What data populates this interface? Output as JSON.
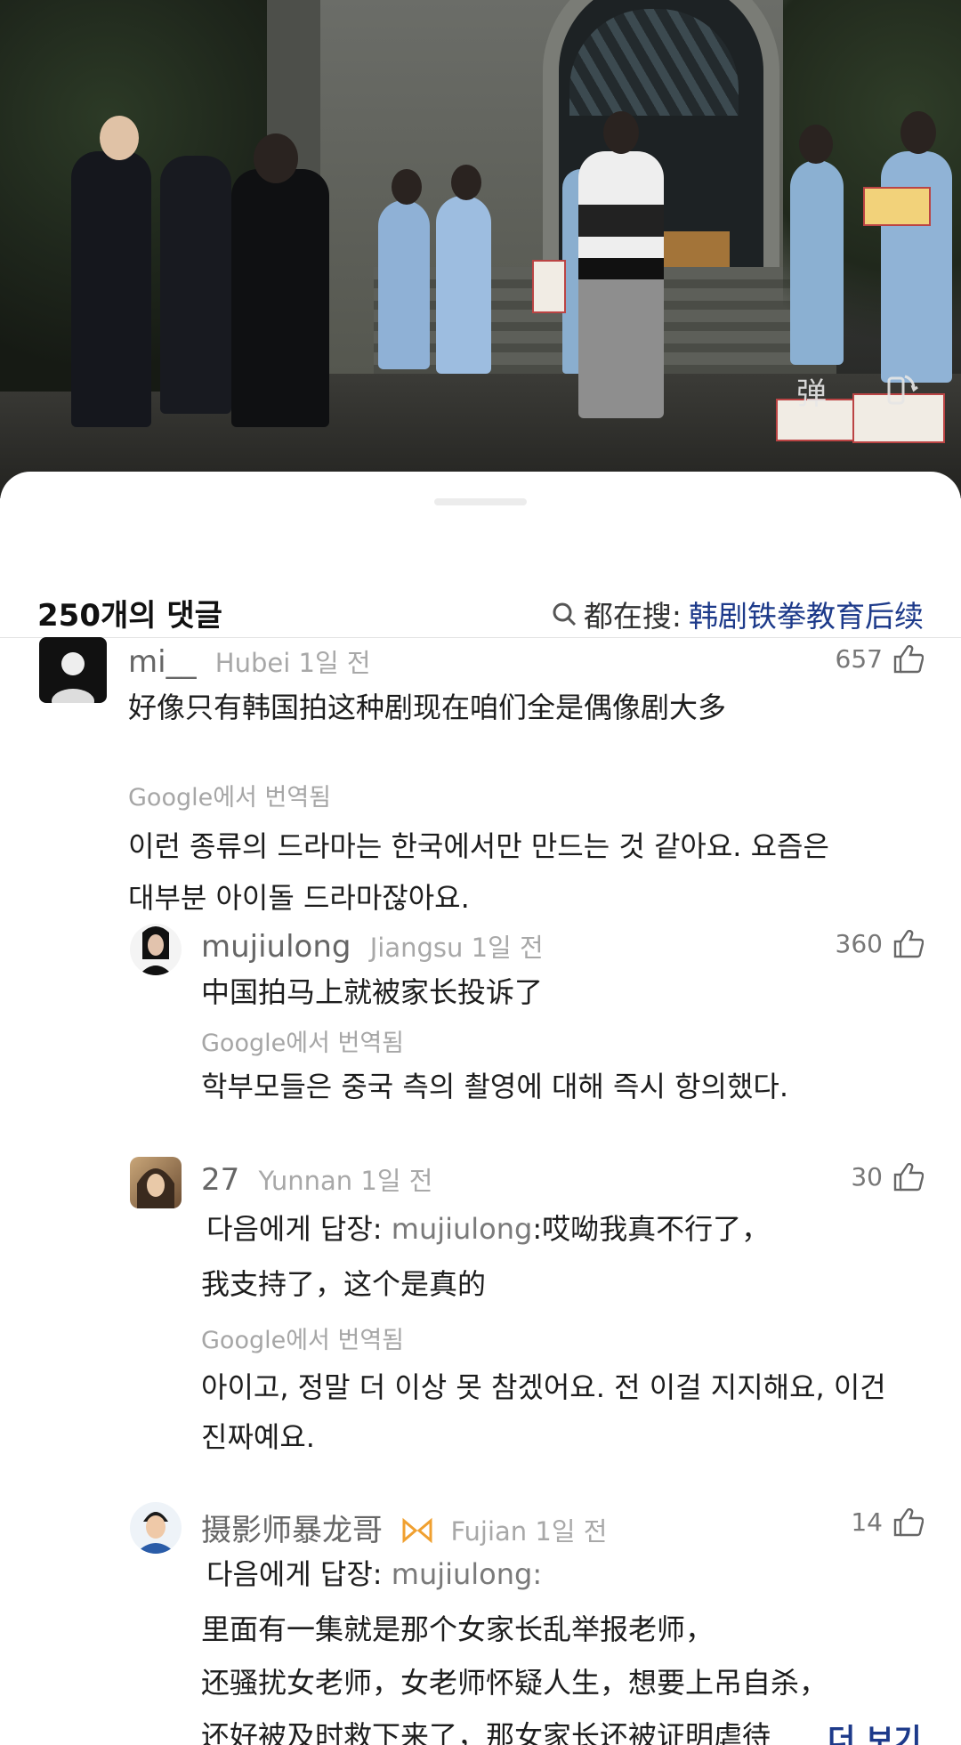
{
  "video": {
    "danmaku_icon": "弹",
    "rotate_icon": "rotate-screen-icon"
  },
  "header": {
    "comment_count": "250개의 댓글",
    "trending_label": "都在搜:",
    "trending_query": "韩剧铁拳教育后续"
  },
  "comments": [
    {
      "user": "mi__",
      "location": "Hubei",
      "time": "1일 전",
      "likes": "657",
      "text": "好像只有韩国拍这种剧现在咱们全是偶像剧大多",
      "translated_by": "Google에서 번역됨",
      "translation_line1": "이런 종류의 드라마는 한국에서만 만드는 것 같아요. 요즘은",
      "translation_line2": "대부분 아이돌 드라마잖아요."
    },
    {
      "user": "mujiulong",
      "location": "Jiangsu",
      "time": "1일 전",
      "likes": "360",
      "text": "中国拍马上就被家长投诉了",
      "translated_by": "Google에서 번역됨",
      "translation": "학부모들은 중국 측의 촬영에 대해 즉시 항의했다."
    },
    {
      "user": "27",
      "location": "Yunnan",
      "time": "1일 전",
      "likes": "30",
      "reply_prefix": "다음에게 답장:",
      "reply_to": "mujiulong",
      "text_line1": ":哎呦我真不行了，",
      "text_line2": "我支持了，这个是真的",
      "translated_by": "Google에서 번역됨",
      "translation_line1": "아이고, 정말 더 이상 못 참겠어요. 전 이걸 지지해요, 이건",
      "translation_line2": "진짜예요."
    },
    {
      "user": "摄影师暴龙哥",
      "location": "Fujian",
      "time": "1일 전",
      "likes": "14",
      "reply_prefix": "다음에게 답장:",
      "reply_to": "mujiulong",
      "reply_colon": ":",
      "text_line1": "里面有一集就是那个女家长乱举报老师，",
      "text_line2": "还骚扰女老师，女老师怀疑人生，想要上吊自杀，",
      "text_line3": "还好被及时救下来了，那女家长还被证明虐待",
      "more": "더 보기"
    }
  ],
  "colors": {
    "accent": "#1d3a8a",
    "muted": "#a8a8a8",
    "badge": "#f0a030"
  }
}
